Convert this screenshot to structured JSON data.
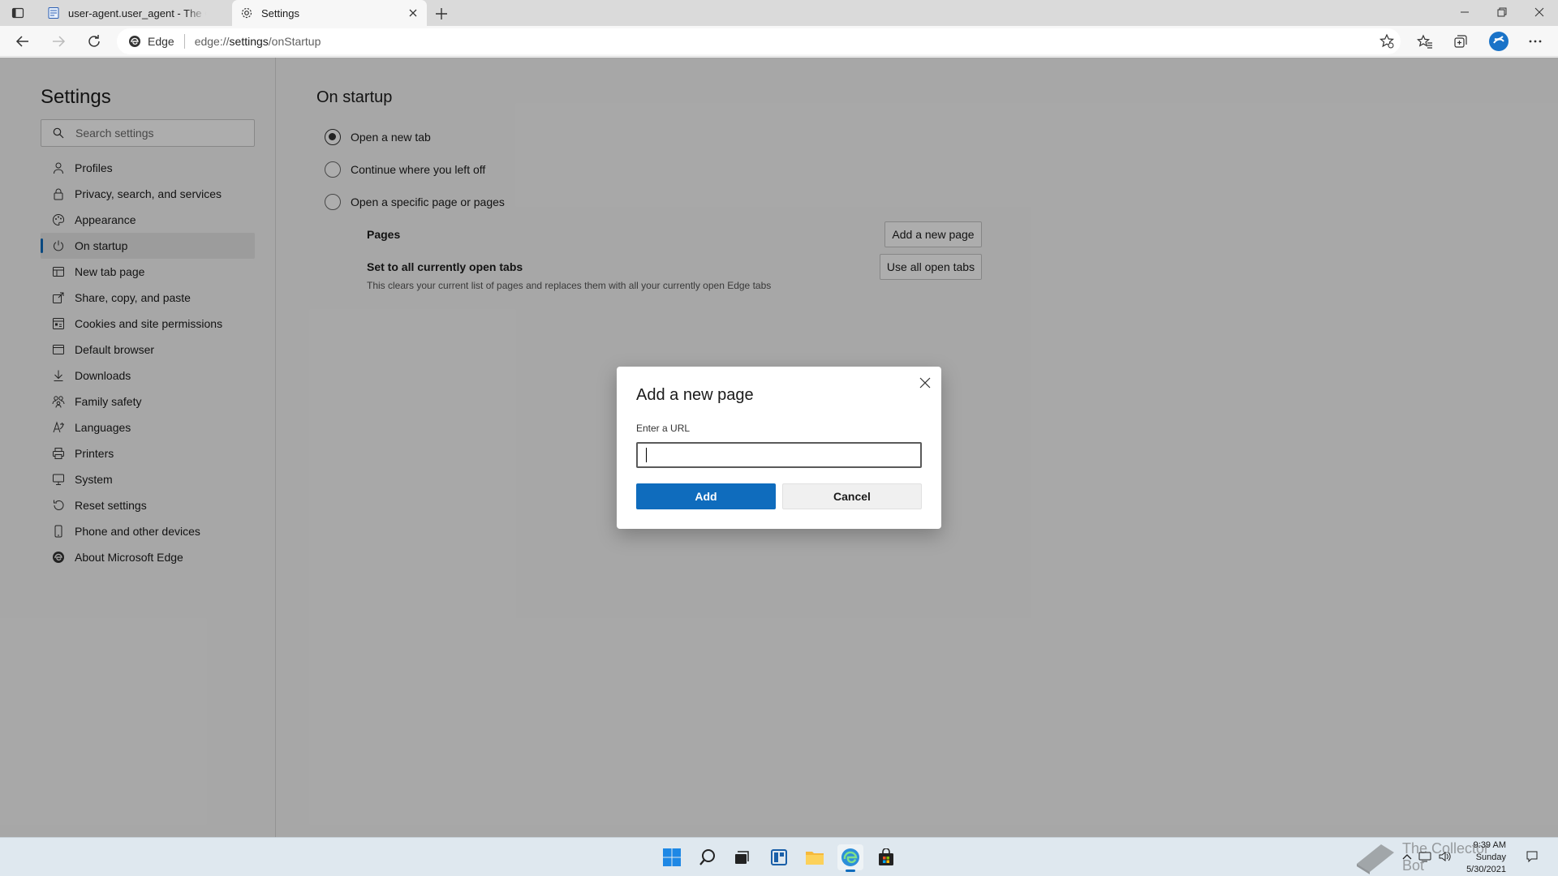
{
  "browser": {
    "tabs": [
      {
        "title": "user-agent.user_agent - The Coll",
        "icon": "document-icon",
        "active": false
      },
      {
        "title": "Settings",
        "icon": "gear-icon",
        "active": true
      }
    ],
    "address": {
      "chip_label": "Edge",
      "url_prefix": "edge://",
      "url_main": "settings",
      "url_suffix": "/onStartup"
    }
  },
  "settings": {
    "title": "Settings",
    "search_placeholder": "Search settings",
    "nav": [
      {
        "label": "Profiles",
        "icon": "person-icon"
      },
      {
        "label": "Privacy, search, and services",
        "icon": "lock-icon"
      },
      {
        "label": "Appearance",
        "icon": "palette-icon"
      },
      {
        "label": "On startup",
        "icon": "power-icon",
        "active": true
      },
      {
        "label": "New tab page",
        "icon": "grid-icon"
      },
      {
        "label": "Share, copy, and paste",
        "icon": "share-icon"
      },
      {
        "label": "Cookies and site permissions",
        "icon": "cookie-icon"
      },
      {
        "label": "Default browser",
        "icon": "browser-icon"
      },
      {
        "label": "Downloads",
        "icon": "download-icon"
      },
      {
        "label": "Family safety",
        "icon": "family-icon"
      },
      {
        "label": "Languages",
        "icon": "language-icon"
      },
      {
        "label": "Printers",
        "icon": "printer-icon"
      },
      {
        "label": "System",
        "icon": "computer-icon"
      },
      {
        "label": "Reset settings",
        "icon": "reset-icon"
      },
      {
        "label": "Phone and other devices",
        "icon": "phone-icon"
      },
      {
        "label": "About Microsoft Edge",
        "icon": "edge-icon"
      }
    ]
  },
  "startup": {
    "heading": "On startup",
    "options": [
      {
        "label": "Open a new tab",
        "selected": true
      },
      {
        "label": "Continue where you left off",
        "selected": false
      },
      {
        "label": "Open a specific page or pages",
        "selected": false
      }
    ],
    "pages_label": "Pages",
    "add_page_button": "Add a new page",
    "set_all_label": "Set to all currently open tabs",
    "set_all_desc": "This clears your current list of pages and replaces them with all your currently open Edge tabs",
    "use_all_button": "Use all open tabs"
  },
  "dialog": {
    "title": "Add a new page",
    "url_label": "Enter a URL",
    "url_value": "",
    "add_button": "Add",
    "cancel_button": "Cancel"
  },
  "taskbar": {
    "time": "9:39 AM",
    "day": "Sunday",
    "date": "5/30/2021",
    "watermark": "The Collector Bot"
  },
  "colors": {
    "accent": "#0f6cbd",
    "overlay": "rgba(0,0,0,0.32)"
  }
}
